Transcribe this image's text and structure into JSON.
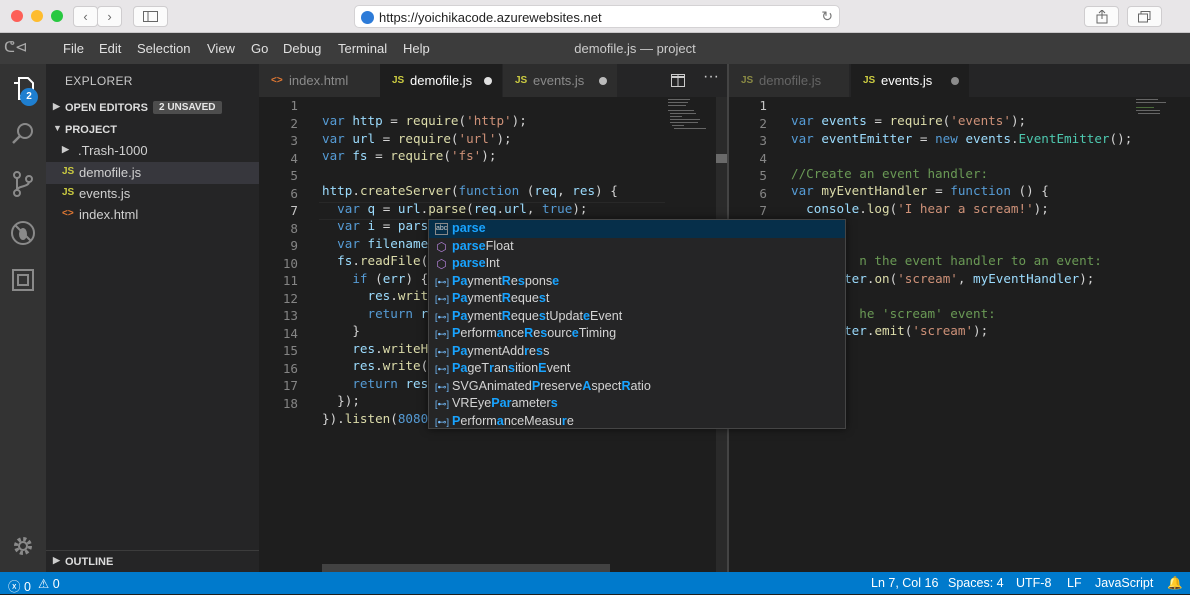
{
  "browser": {
    "url": "https://yoichikacode.azurewebsites.net",
    "nav_back": "‹",
    "nav_forward": "›",
    "sidebar_icon": "sidebar-icon",
    "share_icon": "share-icon",
    "tabs_icon": "tabs-icon"
  },
  "menubar": {
    "items": [
      "File",
      "Edit",
      "Selection",
      "View",
      "Go",
      "Debug",
      "Terminal",
      "Help"
    ],
    "title": "demofile.js — project"
  },
  "activity": {
    "badge": "2",
    "icons": [
      "files-icon",
      "search-icon",
      "source-control-icon",
      "debug-icon",
      "extensions-icon",
      "settings-gear-icon"
    ]
  },
  "sidebar": {
    "title": "EXPLORER",
    "open_editors": "OPEN EDITORS",
    "unsaved": "2 UNSAVED",
    "project": "PROJECT",
    "outline": "OUTLINE",
    "files": [
      {
        "icon": "",
        "name": ".Trash-1000"
      },
      {
        "icon": "JS",
        "name": "demofile.js"
      },
      {
        "icon": "JS",
        "name": "events.js"
      },
      {
        "icon": "<>",
        "name": "index.html"
      }
    ]
  },
  "left_tabs": [
    {
      "icon": "<>",
      "name": "index.html"
    },
    {
      "icon": "JS",
      "name": "demofile.js"
    },
    {
      "icon": "JS",
      "name": "events.js"
    }
  ],
  "right_tabs": [
    {
      "icon": "JS",
      "name": "demofile.js"
    },
    {
      "icon": "JS",
      "name": "events.js"
    }
  ],
  "left_editor": {
    "line_numbers": [
      "1",
      "2",
      "3",
      "4",
      "5",
      "6",
      "7",
      "8",
      "9",
      "10",
      "11",
      "12",
      "13",
      "14",
      "15",
      "16",
      "17",
      "18"
    ]
  },
  "right_editor": {
    "line_numbers": [
      "1",
      "2",
      "3",
      "4",
      "5",
      "6",
      "7"
    ]
  },
  "suggestions": [
    "parse",
    "parseFloat",
    "parseInt",
    "PaymentResponse",
    "PaymentRequest",
    "PaymentRequestUpdateEvent",
    "PerformanceResourceTiming",
    "PaymentAddress",
    "PageTransitionEvent",
    "SVGAnimatedPreserveAspectRatio",
    "VREyeParameters",
    "PerformanceMeasure"
  ],
  "status": {
    "errors": "0",
    "warnings": "0",
    "position": "Ln 7, Col 16",
    "spaces": "Spaces: 4",
    "encoding": "UTF-8",
    "eol": "LF",
    "language": "JavaScript"
  }
}
